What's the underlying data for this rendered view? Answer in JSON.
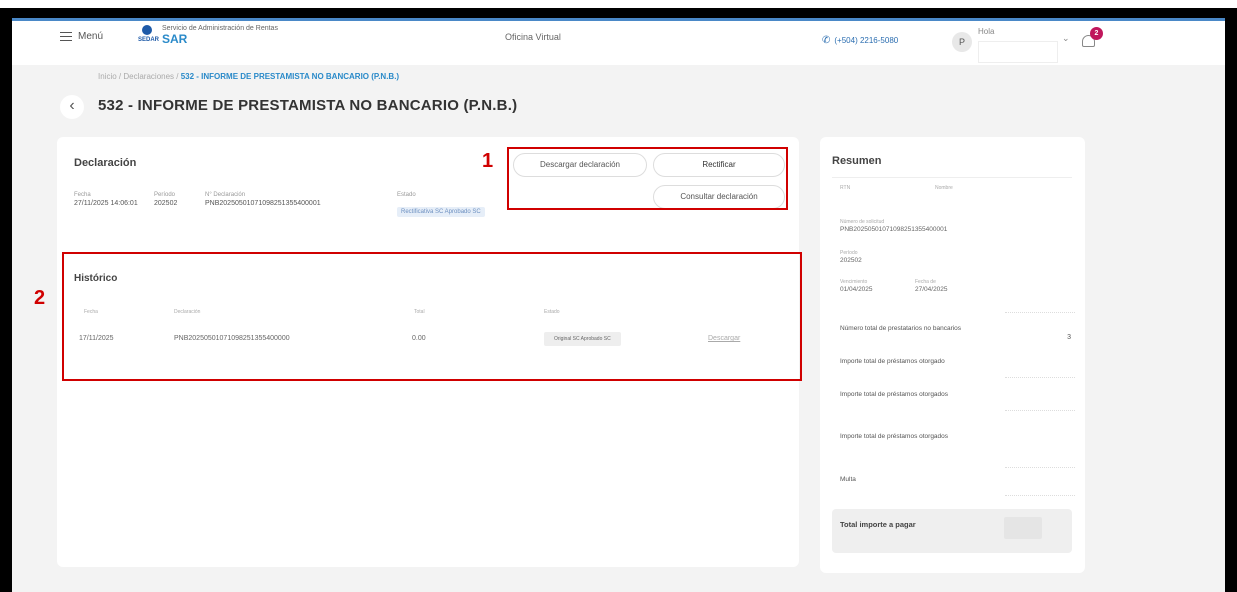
{
  "header": {
    "menu_label": "Menú",
    "logo_small": "Servicio de Administración de Rentas",
    "logo_big": "SAR",
    "logo_mark": "SEDAR",
    "oficina_virtual": "Oficina Virtual",
    "phone": "(+504) 2216-5080",
    "avatar_initial": "P",
    "user_label": "Hola",
    "notification_count": "2"
  },
  "breadcrumb": {
    "prefix": "Inicio / Declaraciones / ",
    "current": "532 - INFORME DE PRESTAMISTA NO BANCARIO (P.N.B.)"
  },
  "page_title": "532 - INFORME DE PRESTAMISTA NO BANCARIO (P.N.B.)",
  "declaracion": {
    "title": "Declaración",
    "fields": [
      {
        "label": "Fecha",
        "value": "27/11/2025 14:06:01"
      },
      {
        "label": "Período",
        "value": "202502"
      },
      {
        "label": "N° Declaración",
        "value": "PNB20250501071098251355400001"
      },
      {
        "label": "Estado",
        "value": "Rectificativa SC Aprobado SC"
      }
    ],
    "buttons": {
      "descargar": "Descargar declaración",
      "rectificar": "Rectificar",
      "consultar": "Consultar declaración"
    }
  },
  "historico": {
    "title": "Histórico",
    "headers": [
      "Fecha",
      "Declaración",
      "Total",
      "Estado"
    ],
    "rows": [
      {
        "fecha": "17/11/2025",
        "declaracion": "PNB20250501071098251355400000",
        "total": "0.00",
        "estado": "Original SC Aprobado SC",
        "accion": "Descargar"
      }
    ]
  },
  "annotations": {
    "one": "1",
    "two": "2"
  },
  "resumen": {
    "title": "Resumen",
    "rtn_label": "RTN",
    "nombre_label": "Nombre",
    "numero_label": "Número de solicitud",
    "numero_value": "PNB20250501071098251355400001",
    "periodo_label": "Período",
    "periodo_value": "202502",
    "vence_label": "Vencimiento",
    "vence_value": "01/04/2025",
    "fecha_label": "Fecha de",
    "fecha_value": "27/04/2025",
    "rows": [
      {
        "label": "Número total de prestatarios no bancarios",
        "value": "3"
      },
      {
        "label": "Importe total de préstamos otorgado",
        "value": ""
      },
      {
        "label": "Importe total de préstamos otorgados",
        "value": ""
      },
      {
        "label": "Importe total de préstamos otorgados",
        "value": ""
      },
      {
        "label": "Multa",
        "value": ""
      }
    ],
    "total_label": "Total importe a pagar"
  }
}
